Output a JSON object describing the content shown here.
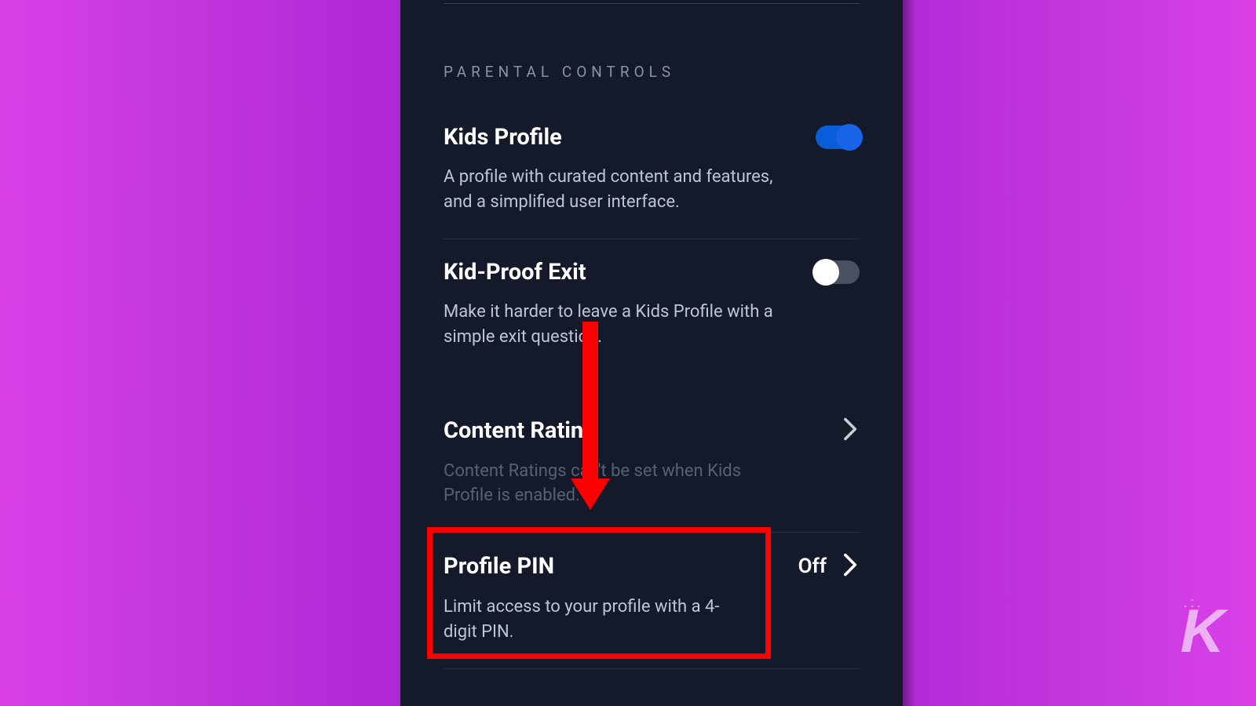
{
  "section": {
    "heading": "PARENTAL CONTROLS"
  },
  "settings": {
    "kidsProfile": {
      "title": "Kids Profile",
      "desc": "A profile with curated content and features, and a simplified user interface.",
      "toggleOn": true
    },
    "kidProofExit": {
      "title": "Kid-Proof Exit",
      "desc": "Make it harder to leave a Kids Profile with a simple exit question.",
      "toggleOn": false
    },
    "contentRating": {
      "title": "Content Rating",
      "desc": "Content Ratings can't be set when Kids Profile is enabled."
    },
    "profilePin": {
      "title": "Profile PIN",
      "desc": "Limit access to your profile with a 4-digit PIN.",
      "status": "Off"
    }
  },
  "watermark": {
    "dots": ".:.",
    "letter": "K"
  },
  "colors": {
    "highlight": "#ff0000",
    "toggleOn": "#1864e8",
    "panel": "#141a2a"
  }
}
